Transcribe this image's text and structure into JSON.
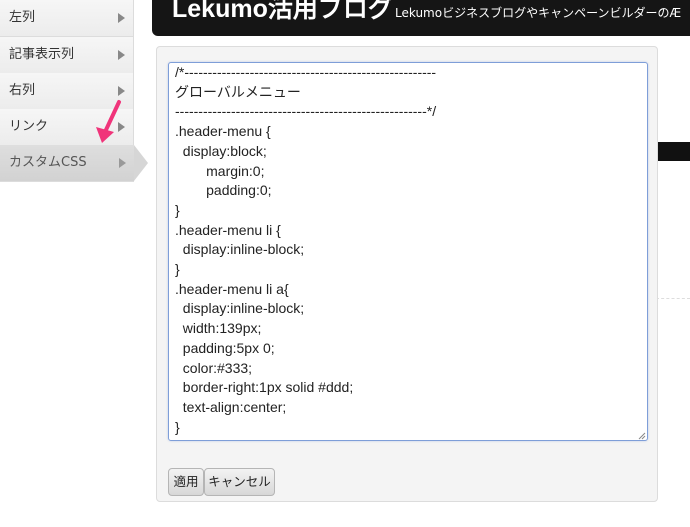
{
  "sidebar": {
    "items": [
      {
        "label": "左列"
      },
      {
        "label": "記事表示列"
      },
      {
        "label": "右列"
      },
      {
        "label": "リンク"
      },
      {
        "label": "カスタムCSS"
      }
    ]
  },
  "header": {
    "title": "Lekumo活用ブログ",
    "description": "LekumoビジネスブログやキャンペーンビルダーのÆ"
  },
  "editor": {
    "css": "/*------------------------------------------------------\nグローバルメニュー\n------------------------------------------------------*/\n.header-menu {\n  display:block;\n        margin:0;\n        padding:0;\n}\n.header-menu li {\n  display:inline-block;\n}\n.header-menu li a{\n  display:inline-block;\n  width:139px;\n  padding:5px 0;\n  color:#333;\n  border-right:1px solid #ddd;\n  text-align:center;\n}",
    "apply_label": "適用",
    "cancel_label": "キャンセル"
  },
  "colors": {
    "annotation_arrow": "#f0347a",
    "header_bg": "#151515",
    "textarea_border": "#7e9ed8"
  }
}
